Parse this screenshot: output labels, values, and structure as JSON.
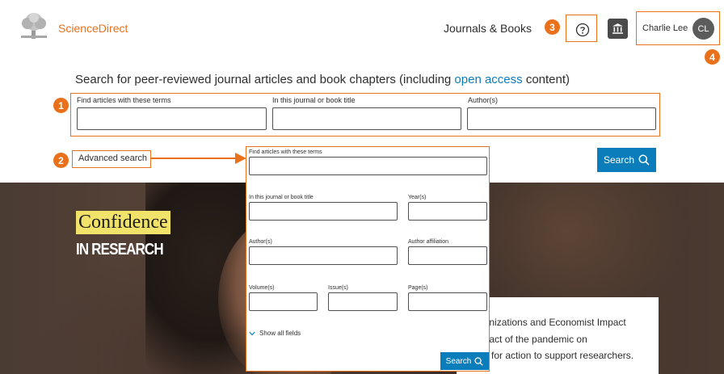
{
  "header": {
    "brand": "ScienceDirect",
    "nav_journals": "Journals & Books",
    "user_name": "Charlie Lee",
    "avatar_initials": "CL"
  },
  "search": {
    "heading_pre": "Search for peer-reviewed journal articles and book chapters (including ",
    "heading_link": "open access",
    "heading_post": " content)",
    "fields": [
      {
        "label": "Find articles with these terms",
        "value": ""
      },
      {
        "label": "In this journal or book title",
        "value": ""
      },
      {
        "label": "Author(s)",
        "value": ""
      }
    ],
    "advanced_link": "Advanced search",
    "search_button": "Search"
  },
  "advanced": {
    "terms_label": "Find articles with these terms",
    "journal_label": "In this journal or book title",
    "years_label": "Year(s)",
    "authors_label": "Author(s)",
    "affiliation_label": "Author affiliation",
    "volume_label": "Volume(s)",
    "issue_label": "Issue(s)",
    "pages_label": "Page(s)",
    "show_all": "Show all fields",
    "search_button": "Search"
  },
  "hero": {
    "line1": "Confidence",
    "line2": "IN RESEARCH",
    "promo_lines": [
      "ganizations and Economist Impact",
      "npact of the pandemic on",
      "as for action to support researchers."
    ]
  },
  "callouts": [
    "1",
    "2",
    "3",
    "4"
  ],
  "colors": {
    "accent": "#e9711c",
    "primary_blue": "#0c7dbb",
    "highlight_yellow": "#f1e36a"
  },
  "icons": {
    "help": "question-circle-icon",
    "institution": "institution-icon",
    "search": "search-icon",
    "chevron": "chevron-down-icon"
  }
}
